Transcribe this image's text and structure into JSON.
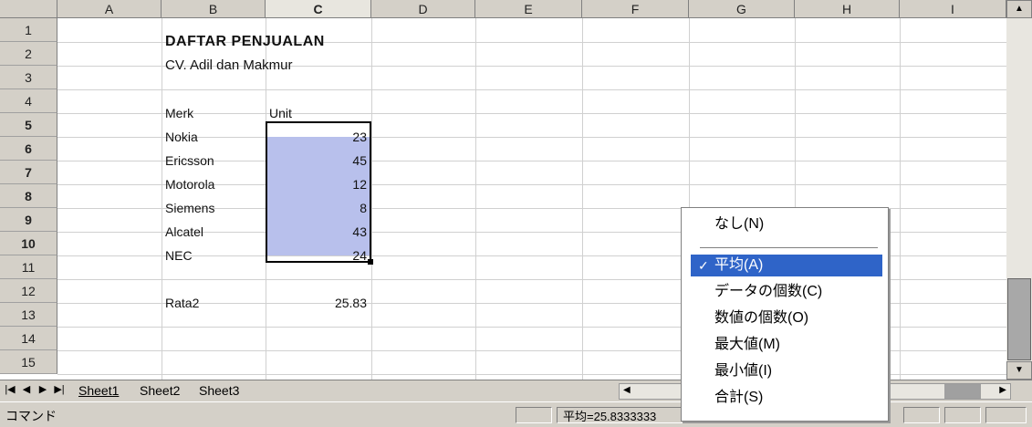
{
  "columns": [
    "A",
    "B",
    "C",
    "D",
    "E",
    "F",
    "G",
    "H",
    "I"
  ],
  "rows": [
    "1",
    "2",
    "3",
    "4",
    "5",
    "6",
    "7",
    "8",
    "9",
    "10",
    "11",
    "12",
    "13",
    "14",
    "15"
  ],
  "cells": {
    "b1": "DAFTAR PENJUALAN",
    "b2": "CV. Adil dan Makmur",
    "b4": "Merk",
    "c4": "Unit",
    "b5": "Nokia",
    "c5": "23",
    "b6": "Ericsson",
    "c6": "45",
    "b7": "Motorola",
    "c7": "12",
    "b8": "Siemens",
    "c8": "8",
    "b9": "Alcatel",
    "c9": "43",
    "b10": "NEC",
    "c10": "24",
    "b12": "Rata2",
    "c12": "25.83"
  },
  "sheet_tabs": [
    "Sheet1",
    "Sheet2",
    "Sheet3"
  ],
  "active_sheet": "Sheet1",
  "status": {
    "mode": "コマンド",
    "summary": "平均=25.8333333"
  },
  "context_menu": {
    "items": [
      "なし(N)",
      "平均(A)",
      "データの個数(C)",
      "数値の個数(O)",
      "最大値(M)",
      "最小値(I)",
      "合計(S)"
    ],
    "checked": "平均(A)"
  },
  "colors": {
    "selection": "#b8c0ec",
    "menu_highlight": "#2f64c8"
  }
}
